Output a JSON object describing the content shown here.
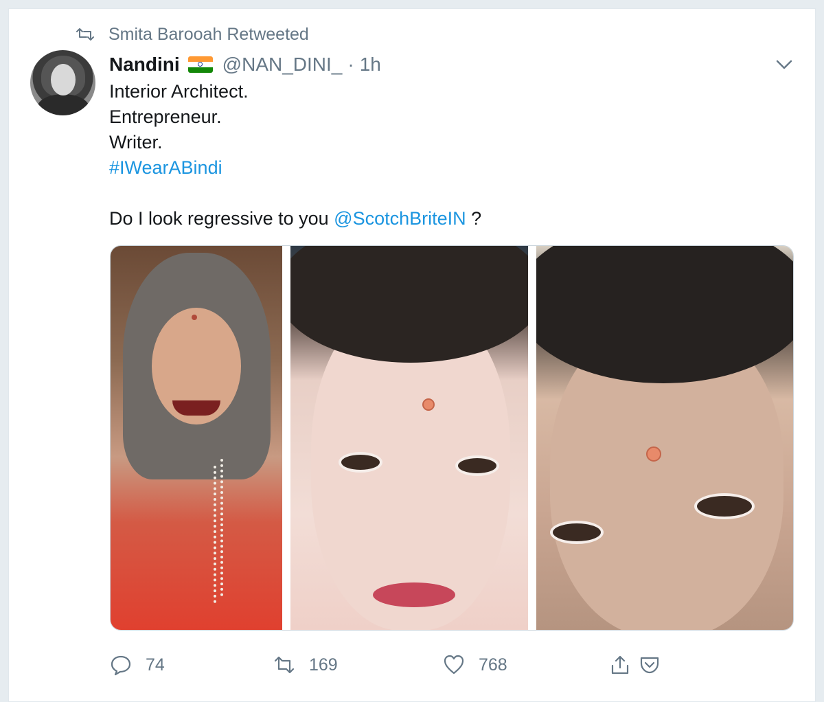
{
  "retweet_context": {
    "label": "Smita Barooah Retweeted"
  },
  "tweet": {
    "author_name": "Nandini",
    "author_handle": "@NAN_DINI_",
    "separator": "·",
    "time": "1h",
    "lines": [
      "Interior Architect.",
      "Entrepreneur.",
      "Writer."
    ],
    "hashtag": "#IWearABindi",
    "question_prefix": "Do I look regressive to you ",
    "mention": "@ScotchBriteIN",
    "question_suffix": " ?",
    "media_count": 3
  },
  "actions": {
    "replies": "74",
    "retweets": "169",
    "likes": "768"
  },
  "colors": {
    "link": "#1b95e0",
    "muted": "#657786",
    "border": "#e1e8ed",
    "background": "#e6ecf0"
  },
  "icons": {
    "retweet_context": "retweet-icon",
    "menu": "chevron-down-icon",
    "reply": "reply-icon",
    "retweet": "retweet-icon",
    "like": "heart-icon",
    "share": "share-icon",
    "save": "pocket-icon"
  }
}
